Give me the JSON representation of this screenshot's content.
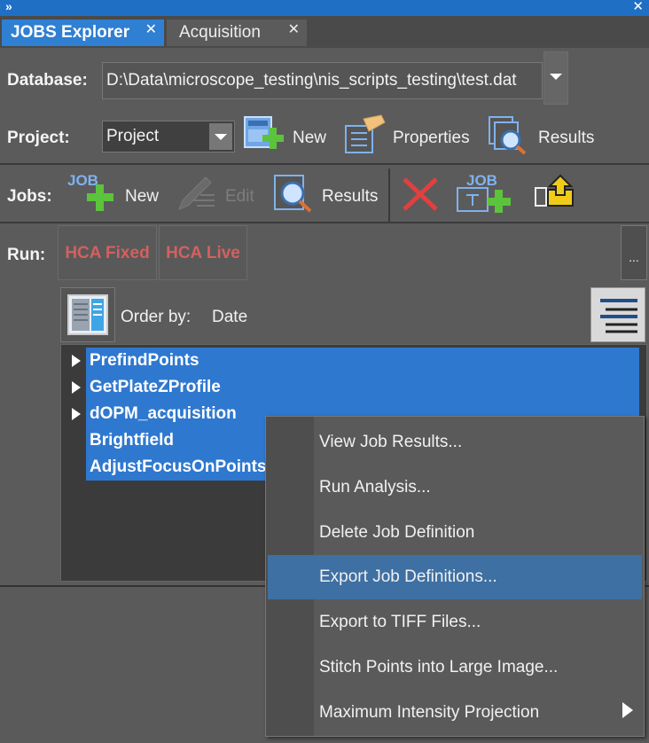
{
  "window": {
    "chevron": "»",
    "close": "✕"
  },
  "tabs": [
    {
      "label": "JOBS Explorer",
      "close": "✕"
    },
    {
      "label": "Acquisition",
      "close": "✕"
    }
  ],
  "database": {
    "label": "Database:",
    "value": "D:\\Data\\microscope_testing\\nis_scripts_testing\\test.dat"
  },
  "project": {
    "label": "Project:",
    "selected": "Project",
    "new_label": "New",
    "properties_label": "Properties",
    "results_label": "Results"
  },
  "jobs": {
    "label": "Jobs:",
    "new_label": "New",
    "edit_label": "Edit",
    "results_label": "Results",
    "icon_text_job": "JOB"
  },
  "run": {
    "label": "Run:",
    "buttons": [
      "HCA Fixed",
      "HCA Live"
    ],
    "more": "..."
  },
  "order": {
    "label": "Order by:",
    "value": "Date"
  },
  "job_list": [
    {
      "name": "PrefindPoints",
      "expandable": true
    },
    {
      "name": "GetPlateZProfile",
      "expandable": true
    },
    {
      "name": "dOPM_acquisition",
      "expandable": true
    },
    {
      "name": "Brightfield",
      "expandable": false
    },
    {
      "name": "AdjustFocusOnPoints",
      "expandable": false
    }
  ],
  "context_menu": {
    "items": [
      "View Job Results...",
      "Run Analysis...",
      "Delete Job Definition",
      "Export Job Definitions...",
      "Export to TIFF Files...",
      "Stitch Points into Large Image...",
      "Maximum Intensity Projection"
    ],
    "highlighted_index": 3
  },
  "colors": {
    "accent": "#2f78cf",
    "run_text": "#d46060",
    "menu_highlight": "#3e70a3",
    "add_green": "#5cc33c",
    "delete_red": "#e04040"
  }
}
